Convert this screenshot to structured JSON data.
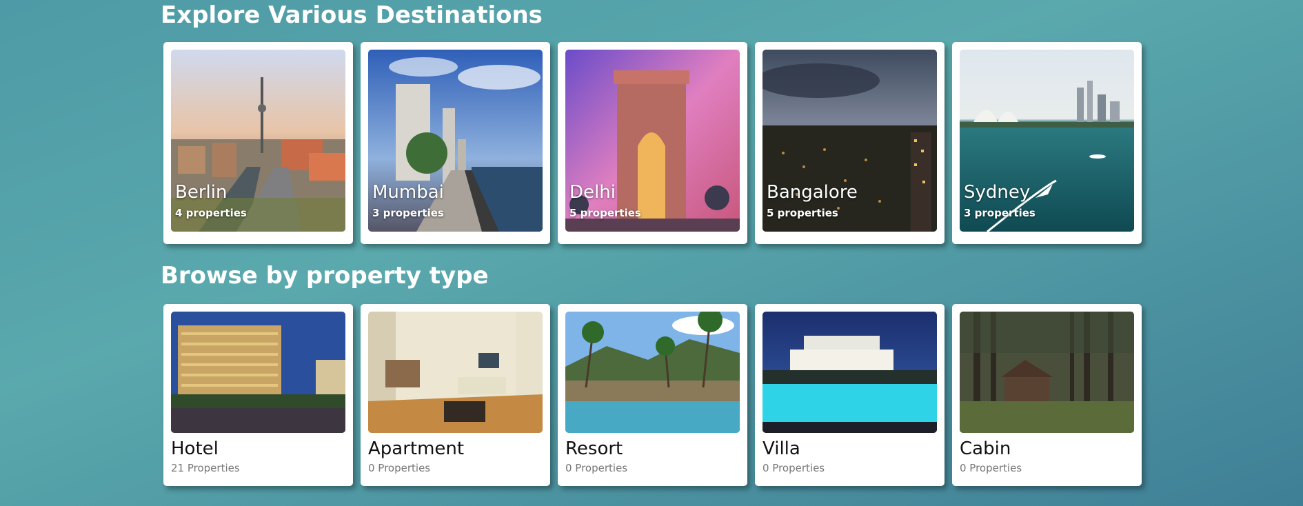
{
  "destinations": {
    "title": "Explore Various Destinations",
    "items": [
      {
        "name": "Berlin",
        "count": "4 properties"
      },
      {
        "name": "Mumbai",
        "count": "3 properties"
      },
      {
        "name": "Delhi",
        "count": "5 properties"
      },
      {
        "name": "Bangalore",
        "count": "5 properties"
      },
      {
        "name": "Sydney",
        "count": "3 properties"
      }
    ]
  },
  "property_types": {
    "title": "Browse by property type",
    "items": [
      {
        "name": "Hotel",
        "count": "21 Properties"
      },
      {
        "name": "Apartment",
        "count": "0 Properties"
      },
      {
        "name": "Resort",
        "count": "0 Properties"
      },
      {
        "name": "Villa",
        "count": "0 Properties"
      },
      {
        "name": "Cabin",
        "count": "0 Properties"
      }
    ]
  }
}
